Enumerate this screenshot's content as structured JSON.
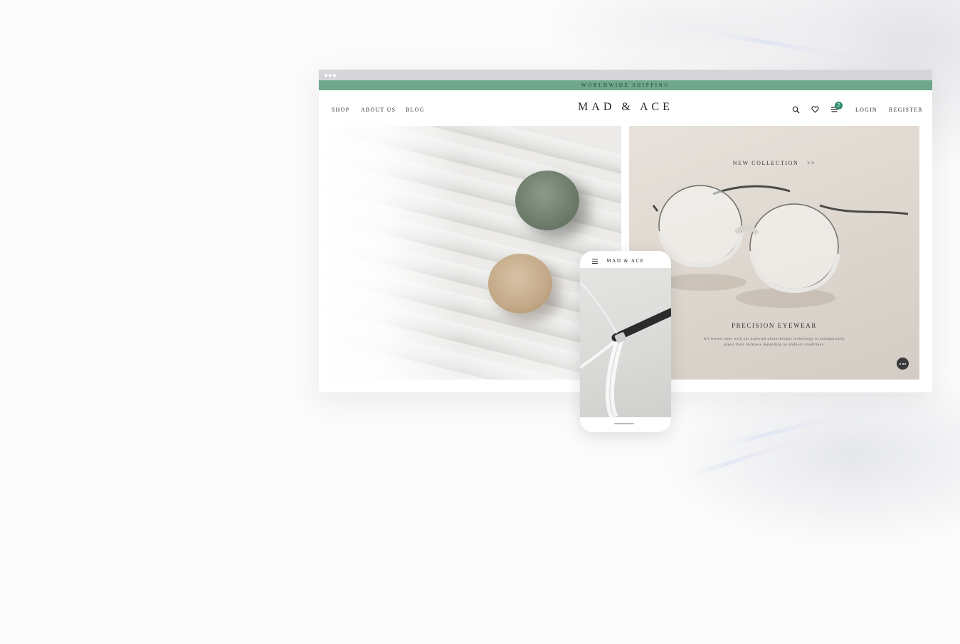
{
  "page": {
    "background": "#fbfbfb"
  },
  "browser": {
    "shipping_banner": "WORLDWIDE SHIPPING",
    "shipping_color": "#6fa78c",
    "nav": {
      "left_links": [
        "SHOP",
        "ABOUT US",
        "BLOG"
      ],
      "brand": "MAD & ACE",
      "icons": [
        "search-icon",
        "heart-icon",
        "cart-icon"
      ],
      "cart_count": "2",
      "login": "LOGIN",
      "register": "REGISTER"
    },
    "hero_right": {
      "cta": "NEW COLLECTION",
      "cta_arrow": ">>",
      "title": "PRECISION EYEWEAR",
      "description": "All lenses come with our patented photochromic technology to automatically adjust their darkness depending on ambient conditions."
    },
    "chat_icon": "chat-bubble-icon"
  },
  "phone": {
    "menu_icon": "hamburger-menu-icon",
    "brand": "MAD & ACE",
    "temple_engraving": "MAD & ACE"
  }
}
